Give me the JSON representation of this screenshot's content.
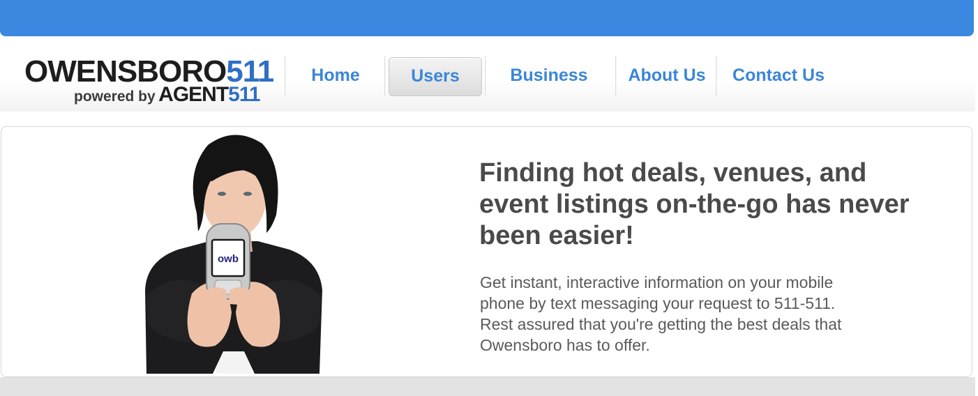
{
  "header": {
    "logo": {
      "main_text": "OWENSBORO",
      "main_number": "511",
      "powered_by": "powered by",
      "agent_text": "AGENT",
      "agent_number": "511"
    },
    "nav": [
      {
        "label": "Home",
        "active": false
      },
      {
        "label": "Users",
        "active": true
      },
      {
        "label": "Business",
        "active": false
      },
      {
        "label": "About Us",
        "active": false
      },
      {
        "label": "Contact Us",
        "active": false
      }
    ]
  },
  "hero": {
    "phone_screen_text": "owb",
    "headline": "Finding hot deals, venues, and\nevent listings on-the-go has never\nbeen easier!",
    "body": "Get instant, interactive information on your mobile\nphone by text messaging your request to 511-511.\nRest assured that you're getting the best deals that\nOwensboro has to offer."
  },
  "colors": {
    "top_bar": "#3a88df",
    "nav_link": "#3a86d8",
    "brand_blue": "#2f6fc5",
    "headline": "#4a4a4a",
    "body_text": "#5a5a5a"
  }
}
